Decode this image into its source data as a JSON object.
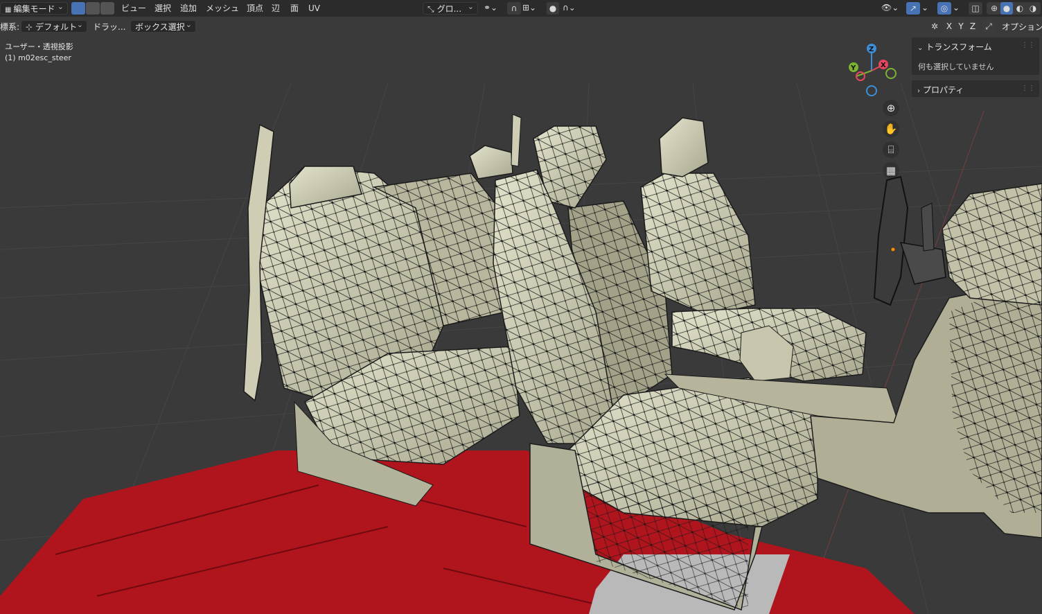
{
  "header": {
    "mode_label": "編集モード",
    "menus": [
      "ビュー",
      "選択",
      "追加",
      "メッシュ",
      "頂点",
      "辺",
      "面",
      "UV"
    ],
    "transform_orientation": "グロ...",
    "options_label": "オプション"
  },
  "tool_header": {
    "orientation_prefix": "標系:",
    "orientation_value": "デフォルト",
    "drag_label": "ドラッ...",
    "drag_value": "ボックス選択",
    "mirror_axes": [
      "X",
      "Y",
      "Z"
    ]
  },
  "viewport": {
    "view_name": "ユーザー・透視投影",
    "object_name": "(1) m02esc_steer"
  },
  "gizmo": {
    "axes": [
      "Z",
      "Y",
      "X"
    ],
    "colors": {
      "x": "#e5475c",
      "y": "#7eb332",
      "z": "#3d8fd8"
    }
  },
  "sidebar": {
    "transform_title": "トランスフォーム",
    "transform_empty": "何も選択していません",
    "properties_title": "プロパティ"
  },
  "colors": {
    "accent": "#4772b3",
    "seat": "#c9c8ad",
    "car_body": "#b0141c",
    "grid": "#3a3a3a"
  }
}
